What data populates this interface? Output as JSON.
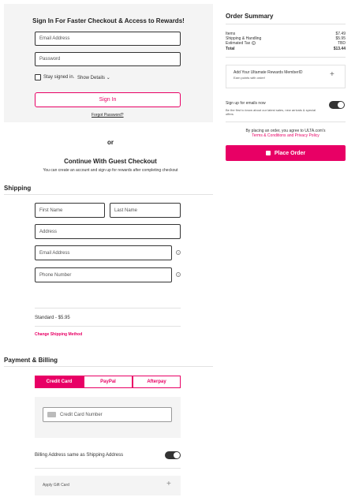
{
  "signin": {
    "title": "Sign In For Faster Checkout & Access to Rewards!",
    "email_placeholder": "Email Address",
    "password_placeholder": "Password",
    "stay_signed_in": "Stay signed in.",
    "show_details": "Show Details",
    "signin_button": "Sign In",
    "forgot_password": "Forgot Password?"
  },
  "or_text": "or",
  "guest": {
    "title": "Continue With Guest Checkout",
    "subtitle": "You can create an account and sign up for rewards after completing checkout"
  },
  "shipping": {
    "title": "Shipping",
    "first_name": "First Name",
    "last_name": "Last Name",
    "address": "Address",
    "email": "Email Address",
    "phone": "Phone Number",
    "method": "Standard - $5.95",
    "change_method": "Change Shipping Method"
  },
  "payment": {
    "title": "Payment & Billing",
    "tabs": [
      "Credit Card",
      "PayPal",
      "Afterpay"
    ],
    "card_number": "Credit Card Number",
    "billing_same": "Billing Address same as Shipping Address",
    "gift_card": "Apply Gift Card"
  },
  "summary": {
    "title": "Order Summary",
    "rows": [
      {
        "label": "Items",
        "value": "$7.49"
      },
      {
        "label": "Shipping & Handling",
        "value": "$5.95"
      },
      {
        "label": "Estimated Tax",
        "value": "TBD"
      },
      {
        "label": "Total",
        "value": "$13.44"
      }
    ],
    "rewards_title": "Add Your Ultamate Rewards MemberID",
    "rewards_sub": "Earn points with order!",
    "emails_title": "Sign up for emails now",
    "emails_sub": "Be the first to know about our latest sales, new arrivals & special offers",
    "agree_text": "By placing an order, you agree to ULTA.com's",
    "agree_links": "Terms & Conditions and Privacy Policy",
    "place_order": "Place Order"
  },
  "colors": {
    "accent": "#e80065"
  }
}
